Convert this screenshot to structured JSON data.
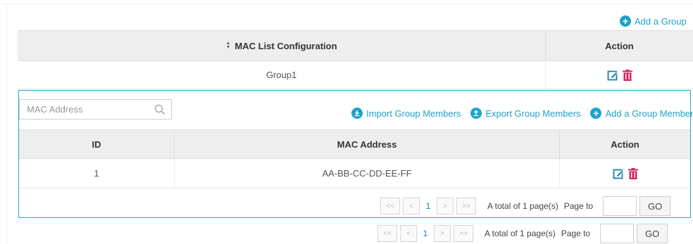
{
  "top_actions": {
    "add_group_label": "Add a Group"
  },
  "group_table": {
    "header_main": "MAC List Configuration",
    "header_action": "Action",
    "rows": [
      {
        "name": "Group1"
      }
    ]
  },
  "members_panel": {
    "search": {
      "placeholder": "MAC Address",
      "value": ""
    },
    "import_label": "Import Group Members",
    "export_label": "Export Group Members",
    "add_member_label": "Add a Group Member",
    "columns": {
      "id": "ID",
      "mac": "MAC Address",
      "action": "Action"
    },
    "rows": [
      {
        "id": "1",
        "mac": "AA-BB-CC-DD-EE-FF"
      }
    ]
  },
  "pager_inner": {
    "first": "<<",
    "prev": "<",
    "current": "1",
    "next": ">",
    "last": ">>",
    "total_text": "A total of 1 page(s)",
    "page_to_label": "Page to",
    "go_label": "GO"
  },
  "pager_outer": {
    "first": "<<",
    "prev": "<",
    "current": "1",
    "next": ">",
    "last": ">>",
    "total_text": "A total of 1 page(s)",
    "page_to_label": "Page to",
    "go_label": "GO"
  },
  "colors": {
    "accent": "#1fa2c9",
    "panel_border": "#29a3d1",
    "delete": "#d6245c",
    "header_bg": "#eeeeee"
  },
  "icons": [
    "plus-circle-icon",
    "sort-icon",
    "edit-icon",
    "trash-icon",
    "search-icon",
    "import-icon",
    "export-icon"
  ]
}
